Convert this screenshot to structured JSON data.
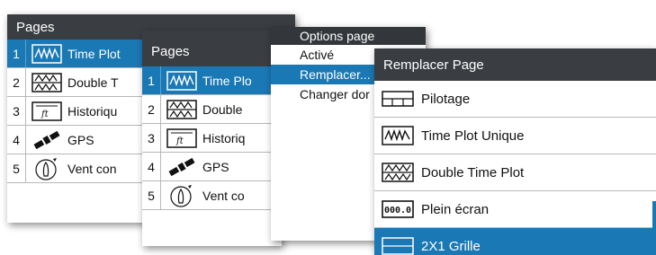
{
  "pages_panel_back": {
    "title": "Pages",
    "items": [
      {
        "num": "1",
        "label": "Time Plot",
        "icon": "time-plot-icon"
      },
      {
        "num": "2",
        "label": "Double T",
        "icon": "double-time-plot-icon"
      },
      {
        "num": "3",
        "label": "Historiqu",
        "icon": "history-icon"
      },
      {
        "num": "4",
        "label": "GPS",
        "icon": "satellite-icon"
      },
      {
        "num": "5",
        "label": "Vent con",
        "icon": "wind-boat-icon"
      }
    ]
  },
  "pages_panel_front": {
    "title": "Pages",
    "items": [
      {
        "num": "1",
        "label": "Time Plo",
        "icon": "time-plot-icon"
      },
      {
        "num": "2",
        "label": "Double",
        "icon": "double-time-plot-icon"
      },
      {
        "num": "3",
        "label": "Historiq",
        "icon": "history-icon"
      },
      {
        "num": "4",
        "label": "GPS",
        "icon": "satellite-icon"
      },
      {
        "num": "5",
        "label": "Vent co",
        "icon": "wind-boat-icon"
      }
    ]
  },
  "options_panel": {
    "title": "Options page",
    "items": [
      "Activé",
      "Remplacer...",
      "Changer dor"
    ]
  },
  "replace_panel": {
    "title": "Remplacer Page",
    "items": [
      {
        "label": "Pilotage",
        "icon": "pilot-icon"
      },
      {
        "label": "Time Plot Unique",
        "icon": "time-plot-icon"
      },
      {
        "label": "Double Time Plot",
        "icon": "double-time-plot-icon"
      },
      {
        "label": "Plein écran",
        "icon": "full-screen-digital-icon",
        "icon_text": "000.0"
      },
      {
        "label": "2X1 Grille",
        "icon": "grid-2x1-icon"
      }
    ]
  },
  "colors": {
    "header": "#3a3d42",
    "selected": "#1a78b4"
  }
}
